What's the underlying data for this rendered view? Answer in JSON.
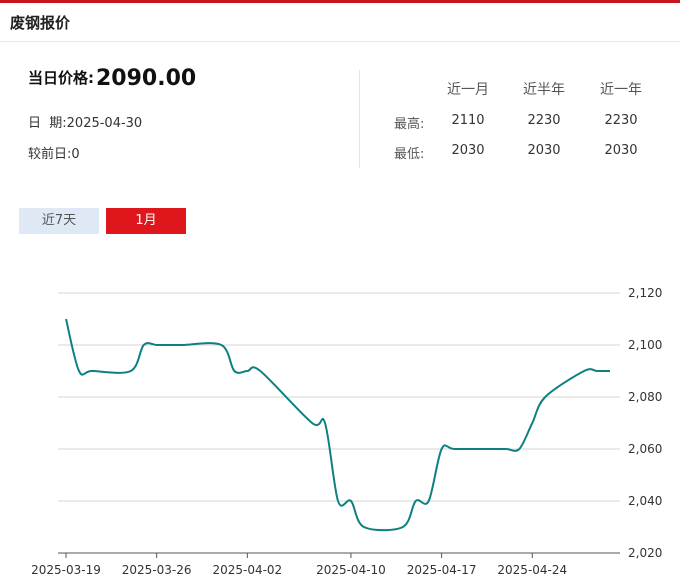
{
  "header": {
    "title": "废钢报价"
  },
  "summary": {
    "price_label": "当日价格:",
    "price": "2090.00",
    "date_label": "日  期:",
    "date": "2025-04-30",
    "prev_label": "较前日:",
    "prev": "0"
  },
  "stats": {
    "columns": [
      "近一月",
      "近半年",
      "近一年"
    ],
    "high_label": "最高:",
    "high": [
      "2110",
      "2230",
      "2230"
    ],
    "low_label": "最低:",
    "low": [
      "2030",
      "2030",
      "2030"
    ]
  },
  "range_buttons": {
    "seven_days": "近7天",
    "one_month": "1月",
    "active": "one_month"
  },
  "chart_data": {
    "type": "line",
    "x": [
      "2025-03-19",
      "2025-03-20",
      "2025-03-21",
      "2025-03-24",
      "2025-03-25",
      "2025-03-26",
      "2025-03-27",
      "2025-03-28",
      "2025-03-31",
      "2025-04-01",
      "2025-04-02",
      "2025-04-03",
      "2025-04-07",
      "2025-04-08",
      "2025-04-09",
      "2025-04-10",
      "2025-04-11",
      "2025-04-14",
      "2025-04-15",
      "2025-04-16",
      "2025-04-17",
      "2025-04-18",
      "2025-04-21",
      "2025-04-22",
      "2025-04-23",
      "2025-04-24",
      "2025-04-25",
      "2025-04-28",
      "2025-04-29",
      "2025-04-30"
    ],
    "series": [
      {
        "values": [
          2110,
          2090,
          2090,
          2090,
          2100,
          2100,
          2100,
          2100,
          2100,
          2090,
          2090,
          2090,
          2070,
          2070,
          2040,
          2040,
          2030,
          2030,
          2040,
          2040,
          2060,
          2060,
          2060,
          2060,
          2060,
          2070,
          2080,
          2090,
          2090,
          2090
        ],
        "color": "#0f8080"
      }
    ],
    "x_tick_labels": [
      "2025-03-19",
      "2025-03-26",
      "2025-04-02",
      "2025-04-10",
      "2025-04-17",
      "2025-04-24"
    ],
    "y_ticks": [
      "2,020",
      "2,040",
      "2,060",
      "2,080",
      "2,100",
      "2,120"
    ],
    "ylim": [
      2020,
      2120
    ],
    "y_axis_position": "right",
    "grid": true
  }
}
